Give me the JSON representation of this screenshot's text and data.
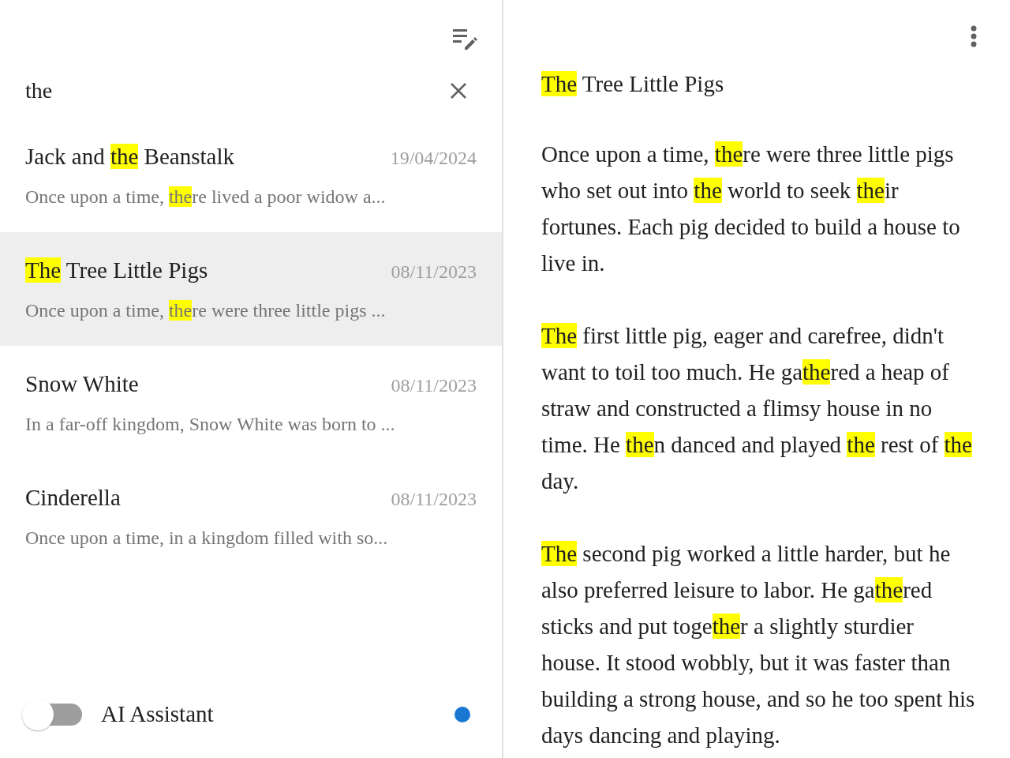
{
  "search": {
    "value": "the"
  },
  "notes": [
    {
      "selected": false,
      "title": [
        {
          "text": "Jack and ",
          "highlight": false
        },
        {
          "text": "the",
          "highlight": true
        },
        {
          "text": " Beanstalk",
          "highlight": false
        }
      ],
      "date": "19/04/2024",
      "preview": [
        {
          "text": "Once upon a time, ",
          "highlight": false
        },
        {
          "text": "the",
          "highlight": true
        },
        {
          "text": "re lived a poor widow a...",
          "highlight": false
        }
      ]
    },
    {
      "selected": true,
      "title": [
        {
          "text": "The",
          "highlight": true
        },
        {
          "text": " Tree Little Pigs",
          "highlight": false
        }
      ],
      "date": "08/11/2023",
      "preview": [
        {
          "text": "Once upon a time, ",
          "highlight": false
        },
        {
          "text": "the",
          "highlight": true
        },
        {
          "text": "re were three little pigs ...",
          "highlight": false
        }
      ]
    },
    {
      "selected": false,
      "title": [
        {
          "text": "Snow White",
          "highlight": false
        }
      ],
      "date": "08/11/2023",
      "preview": [
        {
          "text": "In a far-off kingdom, Snow White was born to ...",
          "highlight": false
        }
      ]
    },
    {
      "selected": false,
      "title": [
        {
          "text": "Cinderella",
          "highlight": false
        }
      ],
      "date": "08/11/2023",
      "preview": [
        {
          "text": "Once upon a time, in a kingdom filled with so...",
          "highlight": false
        }
      ]
    }
  ],
  "assistant": {
    "label": "AI Assistant",
    "on": false
  },
  "document": {
    "title": [
      {
        "text": "The",
        "highlight": true
      },
      {
        "text": " Tree Little Pigs",
        "highlight": false
      }
    ],
    "paragraphs": [
      [
        {
          "text": "Once upon a time, ",
          "highlight": false
        },
        {
          "text": "the",
          "highlight": true
        },
        {
          "text": "re were three little pigs who set out into ",
          "highlight": false
        },
        {
          "text": "the",
          "highlight": true
        },
        {
          "text": " world to seek ",
          "highlight": false
        },
        {
          "text": "the",
          "highlight": true
        },
        {
          "text": "ir fortunes. Each pig decided to build a house to live in.",
          "highlight": false
        }
      ],
      [
        {
          "text": "The",
          "highlight": true
        },
        {
          "text": " first little pig, eager and carefree, didn't want to toil too much. He ga",
          "highlight": false
        },
        {
          "text": "the",
          "highlight": true
        },
        {
          "text": "red a heap of straw and constructed a flimsy house in no time. He ",
          "highlight": false
        },
        {
          "text": "the",
          "highlight": true
        },
        {
          "text": "n danced and played ",
          "highlight": false
        },
        {
          "text": "the",
          "highlight": true
        },
        {
          "text": " rest of ",
          "highlight": false
        },
        {
          "text": "the",
          "highlight": true
        },
        {
          "text": " day.",
          "highlight": false
        }
      ],
      [
        {
          "text": "The",
          "highlight": true
        },
        {
          "text": " second pig worked a little harder, but he also preferred leisure to labor. He ga",
          "highlight": false
        },
        {
          "text": "the",
          "highlight": true
        },
        {
          "text": "red sticks and put toge",
          "highlight": false
        },
        {
          "text": "the",
          "highlight": true
        },
        {
          "text": "r a slightly sturdier house. It stood wobbly, but it was faster than building a strong house, and so he too spent his days dancing and playing.",
          "highlight": false
        }
      ]
    ]
  }
}
